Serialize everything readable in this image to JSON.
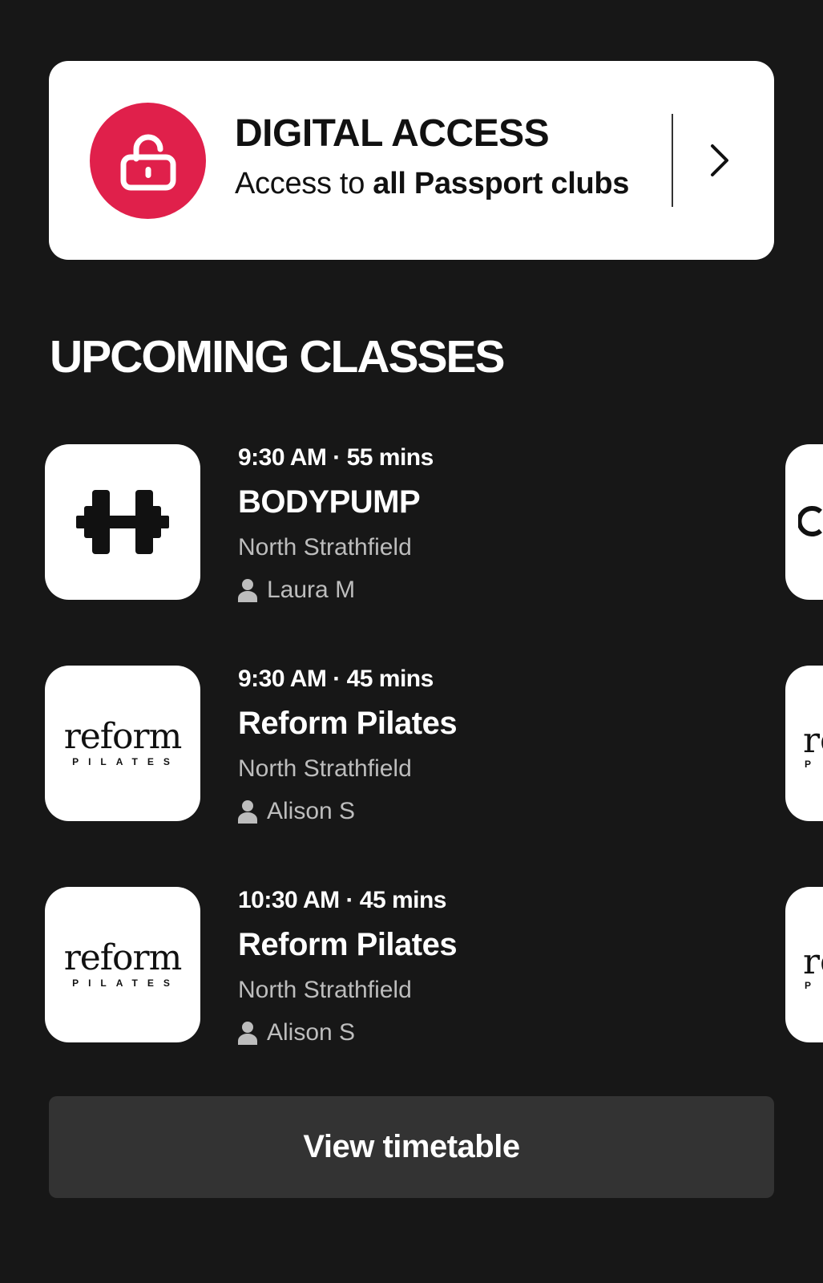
{
  "digital_access": {
    "title": "DIGITAL ACCESS",
    "subtitle_prefix": "Access to ",
    "subtitle_bold": "all Passport clubs",
    "icon": "unlocked-padlock-icon",
    "accent_color": "#e0204b"
  },
  "upcoming": {
    "title": "UPCOMING CLASSES",
    "classes": [
      {
        "time": "9:30 AM · 55 mins",
        "name": "BODYPUMP",
        "club": "North Strathfield",
        "instructor": "Laura M",
        "thumb_icon": "dumbbell-icon"
      },
      {
        "time": "9:30 AM · 45 mins",
        "name": "Reform Pilates",
        "club": "North Strathfield",
        "instructor": "Alison S",
        "logo_word": "reform",
        "logo_sub": "PILATES"
      },
      {
        "time": "10:30 AM · 45 mins",
        "name": "Reform Pilates",
        "club": "North Strathfield",
        "instructor": "Alison S",
        "logo_word": "reform",
        "logo_sub": "PILATES"
      }
    ],
    "peek": [
      {
        "text": ""
      },
      {
        "text": "re",
        "sub": "P"
      },
      {
        "text": "re",
        "sub": "P"
      }
    ]
  },
  "timetable_button": {
    "label": "View timetable",
    "background": "#333333"
  }
}
